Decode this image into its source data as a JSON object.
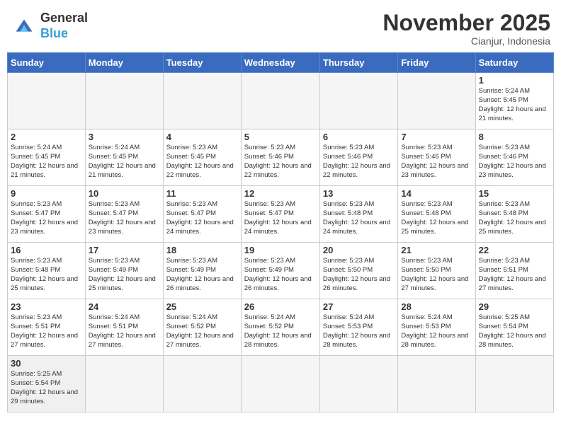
{
  "header": {
    "logo_general": "General",
    "logo_blue": "Blue",
    "month_title": "November 2025",
    "location": "Cianjur, Indonesia"
  },
  "days_of_week": [
    "Sunday",
    "Monday",
    "Tuesday",
    "Wednesday",
    "Thursday",
    "Friday",
    "Saturday"
  ],
  "weeks": [
    {
      "cells": [
        {
          "day": "",
          "info": ""
        },
        {
          "day": "",
          "info": ""
        },
        {
          "day": "",
          "info": ""
        },
        {
          "day": "",
          "info": ""
        },
        {
          "day": "",
          "info": ""
        },
        {
          "day": "",
          "info": ""
        },
        {
          "day": "1",
          "info": "Sunrise: 5:24 AM\nSunset: 5:45 PM\nDaylight: 12 hours and 21 minutes."
        }
      ]
    },
    {
      "cells": [
        {
          "day": "2",
          "info": "Sunrise: 5:24 AM\nSunset: 5:45 PM\nDaylight: 12 hours and 21 minutes."
        },
        {
          "day": "3",
          "info": "Sunrise: 5:24 AM\nSunset: 5:45 PM\nDaylight: 12 hours and 21 minutes."
        },
        {
          "day": "4",
          "info": "Sunrise: 5:23 AM\nSunset: 5:45 PM\nDaylight: 12 hours and 22 minutes."
        },
        {
          "day": "5",
          "info": "Sunrise: 5:23 AM\nSunset: 5:46 PM\nDaylight: 12 hours and 22 minutes."
        },
        {
          "day": "6",
          "info": "Sunrise: 5:23 AM\nSunset: 5:46 PM\nDaylight: 12 hours and 22 minutes."
        },
        {
          "day": "7",
          "info": "Sunrise: 5:23 AM\nSunset: 5:46 PM\nDaylight: 12 hours and 23 minutes."
        },
        {
          "day": "8",
          "info": "Sunrise: 5:23 AM\nSunset: 5:46 PM\nDaylight: 12 hours and 23 minutes."
        }
      ]
    },
    {
      "cells": [
        {
          "day": "9",
          "info": "Sunrise: 5:23 AM\nSunset: 5:47 PM\nDaylight: 12 hours and 23 minutes."
        },
        {
          "day": "10",
          "info": "Sunrise: 5:23 AM\nSunset: 5:47 PM\nDaylight: 12 hours and 23 minutes."
        },
        {
          "day": "11",
          "info": "Sunrise: 5:23 AM\nSunset: 5:47 PM\nDaylight: 12 hours and 24 minutes."
        },
        {
          "day": "12",
          "info": "Sunrise: 5:23 AM\nSunset: 5:47 PM\nDaylight: 12 hours and 24 minutes."
        },
        {
          "day": "13",
          "info": "Sunrise: 5:23 AM\nSunset: 5:48 PM\nDaylight: 12 hours and 24 minutes."
        },
        {
          "day": "14",
          "info": "Sunrise: 5:23 AM\nSunset: 5:48 PM\nDaylight: 12 hours and 25 minutes."
        },
        {
          "day": "15",
          "info": "Sunrise: 5:23 AM\nSunset: 5:48 PM\nDaylight: 12 hours and 25 minutes."
        }
      ]
    },
    {
      "cells": [
        {
          "day": "16",
          "info": "Sunrise: 5:23 AM\nSunset: 5:48 PM\nDaylight: 12 hours and 25 minutes."
        },
        {
          "day": "17",
          "info": "Sunrise: 5:23 AM\nSunset: 5:49 PM\nDaylight: 12 hours and 25 minutes."
        },
        {
          "day": "18",
          "info": "Sunrise: 5:23 AM\nSunset: 5:49 PM\nDaylight: 12 hours and 26 minutes."
        },
        {
          "day": "19",
          "info": "Sunrise: 5:23 AM\nSunset: 5:49 PM\nDaylight: 12 hours and 26 minutes."
        },
        {
          "day": "20",
          "info": "Sunrise: 5:23 AM\nSunset: 5:50 PM\nDaylight: 12 hours and 26 minutes."
        },
        {
          "day": "21",
          "info": "Sunrise: 5:23 AM\nSunset: 5:50 PM\nDaylight: 12 hours and 27 minutes."
        },
        {
          "day": "22",
          "info": "Sunrise: 5:23 AM\nSunset: 5:51 PM\nDaylight: 12 hours and 27 minutes."
        }
      ]
    },
    {
      "cells": [
        {
          "day": "23",
          "info": "Sunrise: 5:23 AM\nSunset: 5:51 PM\nDaylight: 12 hours and 27 minutes."
        },
        {
          "day": "24",
          "info": "Sunrise: 5:24 AM\nSunset: 5:51 PM\nDaylight: 12 hours and 27 minutes."
        },
        {
          "day": "25",
          "info": "Sunrise: 5:24 AM\nSunset: 5:52 PM\nDaylight: 12 hours and 27 minutes."
        },
        {
          "day": "26",
          "info": "Sunrise: 5:24 AM\nSunset: 5:52 PM\nDaylight: 12 hours and 28 minutes."
        },
        {
          "day": "27",
          "info": "Sunrise: 5:24 AM\nSunset: 5:53 PM\nDaylight: 12 hours and 28 minutes."
        },
        {
          "day": "28",
          "info": "Sunrise: 5:24 AM\nSunset: 5:53 PM\nDaylight: 12 hours and 28 minutes."
        },
        {
          "day": "29",
          "info": "Sunrise: 5:25 AM\nSunset: 5:54 PM\nDaylight: 12 hours and 28 minutes."
        }
      ]
    },
    {
      "cells": [
        {
          "day": "30",
          "info": "Sunrise: 5:25 AM\nSunset: 5:54 PM\nDaylight: 12 hours and 29 minutes."
        },
        {
          "day": "",
          "info": ""
        },
        {
          "day": "",
          "info": ""
        },
        {
          "day": "",
          "info": ""
        },
        {
          "day": "",
          "info": ""
        },
        {
          "day": "",
          "info": ""
        },
        {
          "day": "",
          "info": ""
        }
      ]
    }
  ]
}
